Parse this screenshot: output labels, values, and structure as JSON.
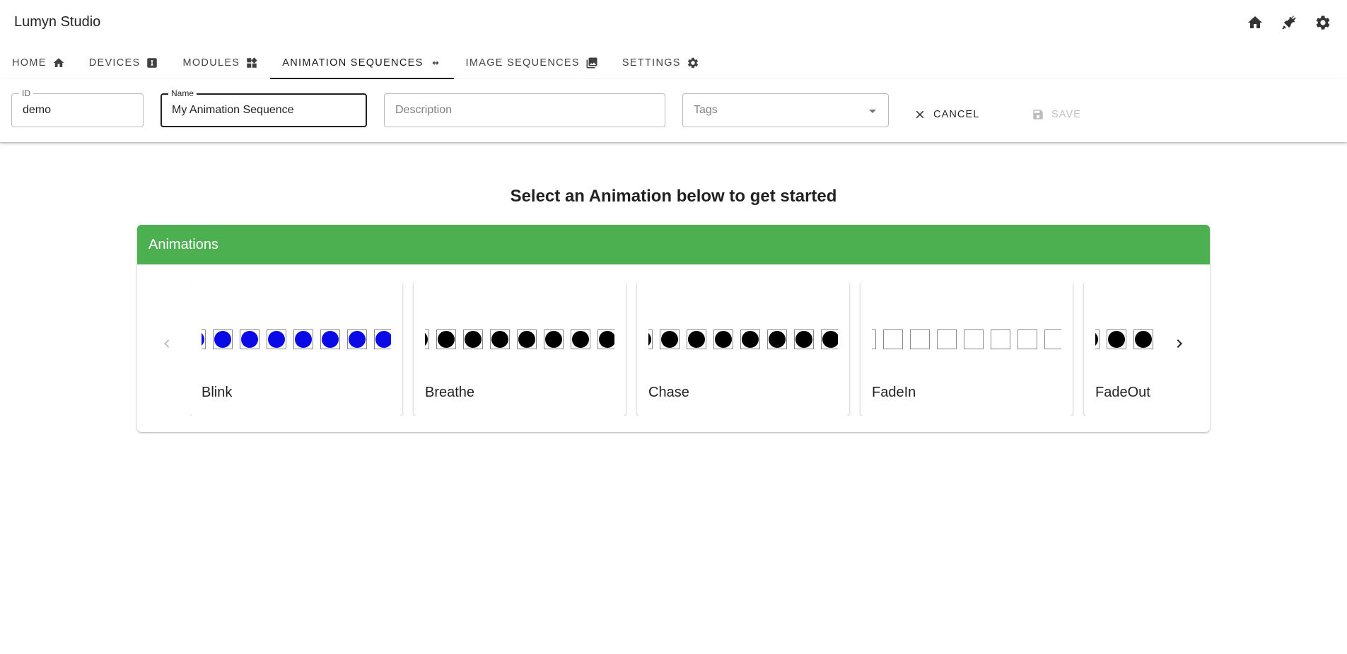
{
  "app": {
    "title": "Lumyn Studio",
    "top_icons": [
      "home-icon",
      "plug-icon",
      "gear-icon"
    ]
  },
  "tabs": [
    {
      "label": "HOME",
      "icon": "home-icon",
      "active": false
    },
    {
      "label": "DEVICES",
      "icon": "device-icon",
      "active": false
    },
    {
      "label": "MODULES",
      "icon": "widgets-icon",
      "active": false
    },
    {
      "label": "ANIMATION SEQUENCES",
      "icon": "arrows-horizontal-icon",
      "active": true
    },
    {
      "label": "IMAGE SEQUENCES",
      "icon": "photo-library-icon",
      "active": false
    },
    {
      "label": "SETTINGS",
      "icon": "gear-icon",
      "active": false
    }
  ],
  "form": {
    "id": {
      "label": "ID",
      "value": "demo"
    },
    "name": {
      "label": "Name",
      "value": "My Animation Sequence"
    },
    "description": {
      "placeholder": "Description",
      "value": ""
    },
    "tags": {
      "placeholder": "Tags",
      "value": ""
    },
    "cancel_label": "CANCEL",
    "save_label": "SAVE"
  },
  "main": {
    "heading": "Select an Animation below to get started",
    "panel_title": "Animations",
    "panel_color": "#4caf50"
  },
  "animations": [
    {
      "name": "Blink",
      "led_color": "#0a0ae6",
      "led_on": true
    },
    {
      "name": "Breathe",
      "led_color": "#000000",
      "led_on": true
    },
    {
      "name": "Chase",
      "led_color": "#000000",
      "led_on": true
    },
    {
      "name": "FadeIn",
      "led_color": "#ffffff",
      "led_on": false
    },
    {
      "name": "FadeOut",
      "led_color": "#000000",
      "led_on": true
    }
  ]
}
